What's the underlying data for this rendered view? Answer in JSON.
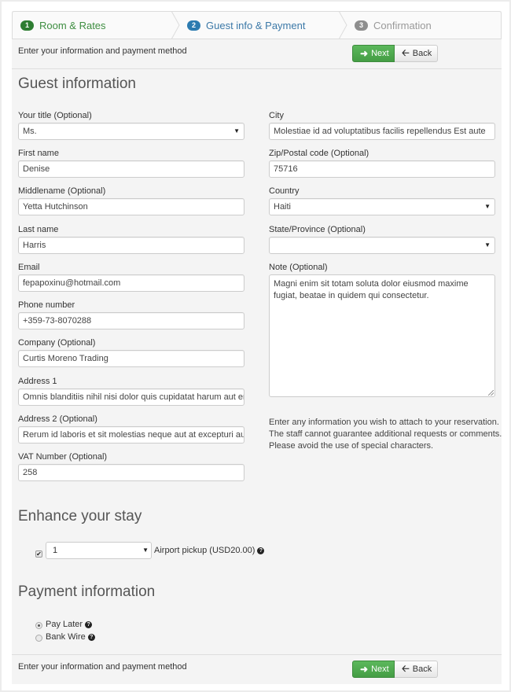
{
  "steps": [
    {
      "number": "1",
      "label": "Room & Rates",
      "state": "completed"
    },
    {
      "number": "2",
      "label": "Guest info & Payment",
      "state": "active"
    },
    {
      "number": "3",
      "label": "Confirmation",
      "state": "upcoming"
    }
  ],
  "action_bar": {
    "text": "Enter your information and payment method",
    "next_label": "Next",
    "back_label": "Back",
    "next_icon": "arrow-right-icon",
    "back_icon": "arrow-left-icon"
  },
  "guest_info": {
    "heading": "Guest information",
    "left_fields": [
      {
        "label": "Your title (Optional)",
        "value": "Ms.",
        "type": "select"
      },
      {
        "label": "First name",
        "value": "Denise",
        "type": "text"
      },
      {
        "label": "Middlename (Optional)",
        "value": "Yetta Hutchinson",
        "type": "text"
      },
      {
        "label": "Last name",
        "value": "Harris",
        "type": "text"
      },
      {
        "label": "Email",
        "value": "fepapoxinu@hotmail.com",
        "type": "text"
      },
      {
        "label": "Phone number",
        "value": "+359-73-8070288",
        "type": "text"
      },
      {
        "label": "Company (Optional)",
        "value": "Curtis Moreno Trading",
        "type": "text"
      },
      {
        "label": "Address 1",
        "value": "Omnis blanditiis nihil nisi dolor quis cupidatat harum aut eni",
        "type": "text"
      },
      {
        "label": "Address 2 (Optional)",
        "value": "Rerum id laboris et sit molestias neque aut at excepturi aut",
        "type": "text"
      },
      {
        "label": "VAT Number (Optional)",
        "value": "258",
        "type": "text"
      }
    ],
    "right_fields": [
      {
        "label": "City",
        "value": "Molestiae id ad voluptatibus facilis repellendus Est aute",
        "type": "text"
      },
      {
        "label": "Zip/Postal code (Optional)",
        "value": "75716",
        "type": "text"
      },
      {
        "label": "Country",
        "value": "Haiti",
        "type": "select"
      },
      {
        "label": "State/Province (Optional)",
        "value": "",
        "type": "select"
      }
    ],
    "note": {
      "label": "Note (Optional)",
      "value": "Magni enim sit totam soluta dolor eiusmod maxime fugiat, beatae in quidem qui consectetur."
    },
    "note_help": "Enter any information you wish to attach to your reservation. The staff cannot guarantee additional requests or comments. Please avoid the use of special characters."
  },
  "enhance": {
    "heading": "Enhance your stay",
    "extras": [
      {
        "checked": true,
        "quantity": "1",
        "label": "Airport pickup (USD20.00)",
        "help_icon": "question-circle-icon"
      }
    ]
  },
  "payment": {
    "heading": "Payment information",
    "methods": [
      {
        "label": "Pay Later",
        "selected": true,
        "help_icon": "question-circle-icon"
      },
      {
        "label": "Bank Wire",
        "selected": false,
        "help_icon": "question-circle-icon"
      }
    ]
  },
  "colors": {
    "step_completed": "#3e8e41",
    "step_active": "#3c79a8",
    "step_upcoming": "#999999",
    "next_button": "#4cae4c",
    "background": "#f4f4f4"
  }
}
